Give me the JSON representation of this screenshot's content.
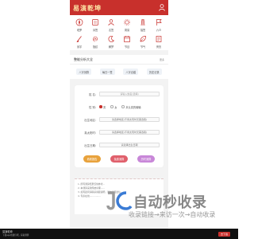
{
  "app": {
    "logo_char_1": "易",
    "logo_char_2": "演",
    "logo_char_3": "乾",
    "logo_char_4": "坤"
  },
  "colors": {
    "brand_red": "#c8302c",
    "logo_gold": "#ffe9a8"
  },
  "grid": [
    {
      "label": "塔罗",
      "icon": "compass-icon"
    },
    {
      "label": "诗签",
      "icon": "stamp-icon"
    },
    {
      "label": "名签",
      "icon": "person-icon"
    },
    {
      "label": "周易",
      "icon": "gear-icon"
    },
    {
      "label": "抽签",
      "icon": "stick-icon"
    },
    {
      "label": "六爻",
      "icon": "flag-icon"
    },
    {
      "label": "测字",
      "icon": "brush-icon"
    },
    {
      "label": "指纹",
      "icon": "fingerprint-icon"
    },
    {
      "label": "解梦",
      "icon": "moon-icon"
    },
    {
      "label": "节目",
      "icon": "calendar-icon"
    },
    {
      "label": "节气",
      "icon": "leaf-icon"
    },
    {
      "label": "黄历",
      "icon": "book-icon"
    }
  ],
  "section": {
    "title": "整能分析大全",
    "more": "更多"
  },
  "tabs": [
    "八字测算",
    "每日一签",
    "八字合婚",
    "历史记录"
  ],
  "form": {
    "name_label": "姓 名:",
    "name_placeholder": "请输入姓名(选填)",
    "gender_label": "性 别:",
    "gender_male": "男",
    "gender_female": "女",
    "gender_unknown": "未认真的输输",
    "birthplace_label": "出生地区:",
    "birthplace_value": "请选择地区(不用太现时无需选取)",
    "true_solar_label": "真太阳时:",
    "true_solar_value": "请选择地区(不用太现时无需选取)",
    "birthdate_label": "出生日期:",
    "birthdate_value": "请选择出生日期"
  },
  "buttons": [
    {
      "label": "看看报告",
      "color": "#e8a23c"
    },
    {
      "label": "免费测算",
      "color": "#e0606c"
    },
    {
      "label": "历时测算",
      "color": "#c887d8"
    }
  ],
  "notes": [
    "1. 所有测算结果仅供参考...",
    "2. 本测算采用传统命理......",
    "3. 如有疑问请联系客服说明，请勿盲目迷信。",
    "4. 专家在线................"
  ],
  "footer": {
    "line1": "易演乾坤",
    "line2": "下载app找我们吧，获取测算",
    "download": "去下载"
  },
  "watermark": {
    "main": "自动秒收录",
    "sub": "收录链接→来访一次→自动收录"
  }
}
